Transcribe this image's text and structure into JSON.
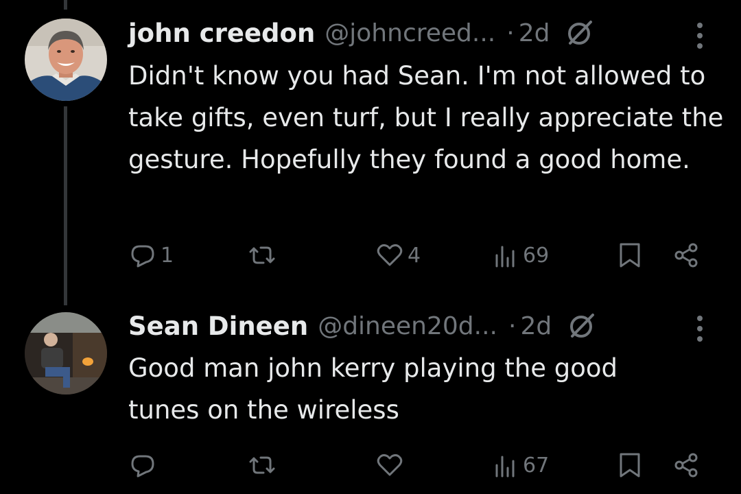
{
  "replies": [
    {
      "name": "john creedon",
      "handle": "@johncreed...",
      "separator": "·",
      "time": "2d",
      "text": "Didn't know you had Sean. I'm not allowed to take gifts, even turf, but I really appreciate the gesture. Hopefully they found a good home.",
      "reply_count": "1",
      "retweet_count": "",
      "like_count": "4",
      "view_count": "69"
    },
    {
      "name": "Sean Dineen",
      "handle": "@dineen20d...",
      "separator": "·",
      "time": "2d",
      "text": "Good man john kerry playing the good tunes on the wireless",
      "reply_count": "",
      "retweet_count": "",
      "like_count": "",
      "view_count": "67"
    }
  ],
  "colors": {
    "background": "#000000",
    "primary_text": "#e7e9ea",
    "secondary_text": "#71767b",
    "thread_line": "#333639"
  },
  "icons": [
    "reply-icon",
    "retweet-icon",
    "like-icon",
    "views-icon",
    "bookmark-icon",
    "share-icon",
    "verified-icon",
    "more-icon"
  ]
}
